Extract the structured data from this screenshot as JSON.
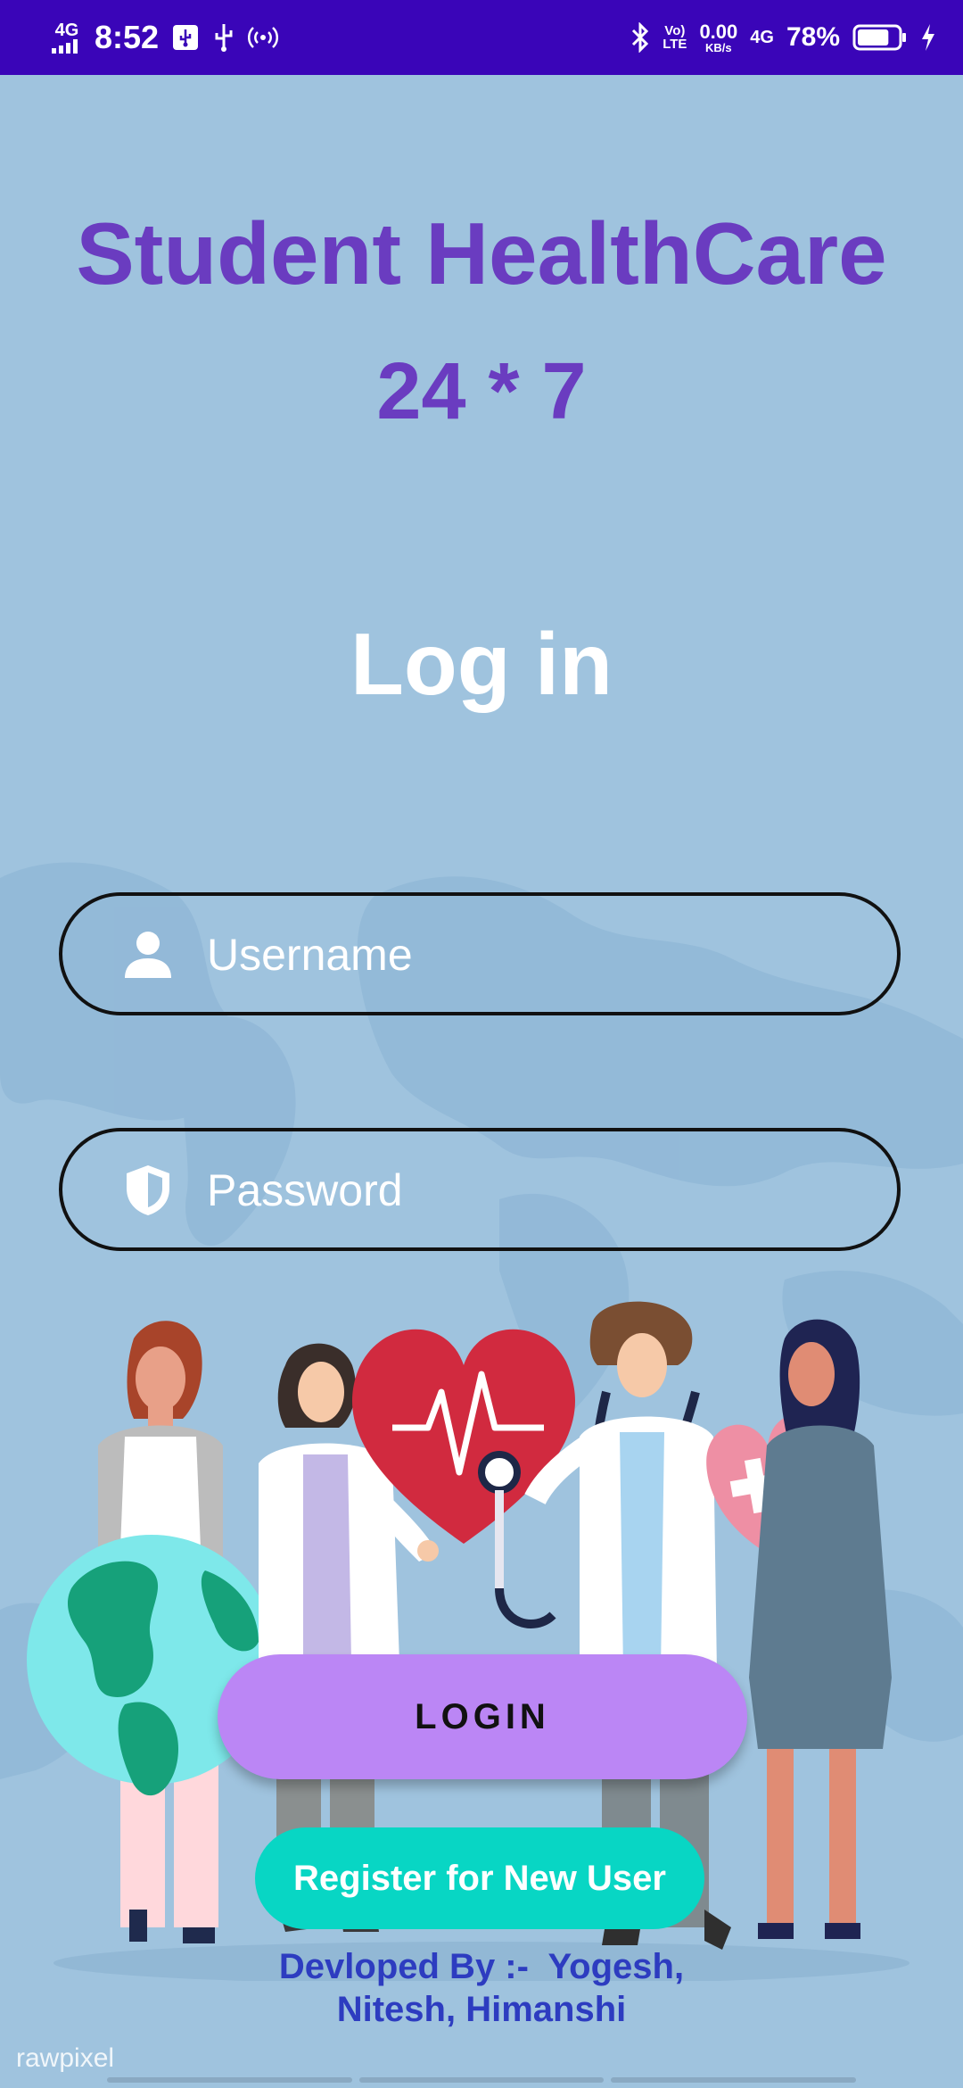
{
  "status_bar": {
    "network_left": "4G",
    "time": "8:52",
    "volte_top": "Vo)",
    "volte_bottom": "LTE",
    "speed_value": "0.00",
    "speed_unit": "KB/s",
    "network_right": "4G",
    "battery_percent": "78%",
    "battery_level": 0.78
  },
  "header": {
    "title": "Student HealthCare",
    "subtitle": "24 * 7"
  },
  "login": {
    "heading": "Log in",
    "username_placeholder": "Username",
    "password_placeholder": "Password",
    "login_label": "LOGIN",
    "register_label": "Register for New User"
  },
  "footer": {
    "credits_line1": "Devloped By :-  Yogesh,",
    "credits_line2": "Nitesh, Himanshi",
    "watermark": "rawpixel"
  },
  "colors": {
    "status_bar": "#3a05b8",
    "background": "#9fc3de",
    "title": "#6a3cc0",
    "login_button": "#bb86f5",
    "register_button": "#08d6c4",
    "credits": "#2d3cc0"
  },
  "icons": [
    "signal-icon",
    "usb-icon",
    "hotspot-icon",
    "bluetooth-icon",
    "battery-icon",
    "charging-icon",
    "user-icon",
    "shield-icon"
  ]
}
